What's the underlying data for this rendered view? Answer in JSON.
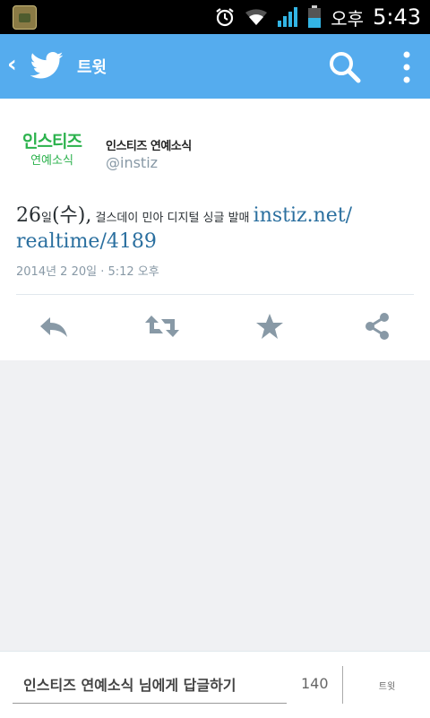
{
  "status_bar": {
    "ampm": "오후",
    "time": "5:43"
  },
  "action_bar": {
    "title": "트윗"
  },
  "tweet": {
    "avatar_top": "인스티즈",
    "avatar_bottom": "연예소식",
    "user_name": "인스티즈 연예소식",
    "handle": "@instiz",
    "text_num": "26",
    "text_day": "일",
    "text_paren": "(수),",
    "text_body": " 걸스데이 민아 디지털 싱글 발매 ",
    "link": "instiz.net/ realtime/4189",
    "timestamp": "2014년 2 20일 · 5:12 오후"
  },
  "reply_bar": {
    "placeholder": "인스티즈 연예소식 님에게 답글하기",
    "char_count": "140",
    "tweet_button": "트윗"
  },
  "colors": {
    "brand": "#55acee",
    "avatar_green": "#2bb24c",
    "link": "#2a6f9f",
    "icon_gray": "#8899a6"
  },
  "icons": [
    "app-icon",
    "alarm-icon",
    "wifi-icon",
    "signal-icon",
    "battery-icon",
    "twitter-bird-icon",
    "search-icon",
    "overflow-menu-icon",
    "reply-icon",
    "retweet-icon",
    "favorite-star-icon",
    "share-icon"
  ]
}
